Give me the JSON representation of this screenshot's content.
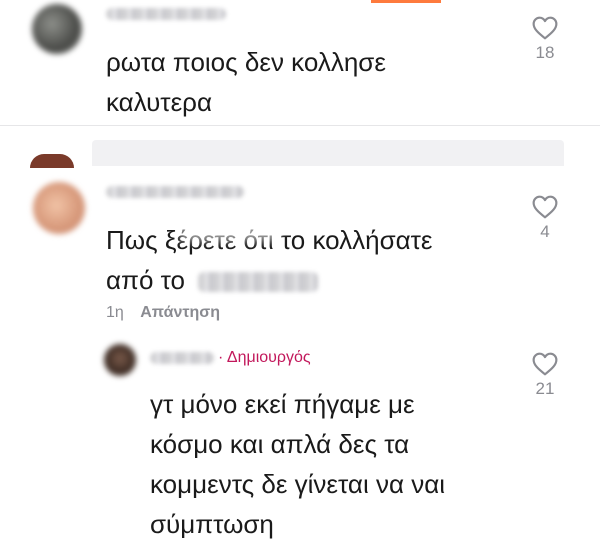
{
  "comments": [
    {
      "text_lines": [
        "ρωτα ποιος δεν κολλησε",
        "καλυτερα"
      ],
      "likes": "18",
      "heart_icon": "heart-outline-icon"
    },
    {
      "text_lines": [
        "Πως ξέρετε ότι το κολλήσατε",
        "από το"
      ],
      "likes": "4",
      "time": "1η",
      "reply_label": "Απάντηση",
      "heart_icon": "heart-outline-icon"
    }
  ],
  "reply": {
    "creator_label": "· Δημιουργός",
    "text_lines": [
      "γτ μόνο εκεί πήγαμε με",
      "κόσμο και απλά δες τα",
      "κομμεντς δε γίνεται να ναι",
      "σύμπτωση"
    ],
    "likes": "21",
    "heart_icon": "heart-outline-icon"
  },
  "colors": {
    "creator_accent": "#c2185b",
    "muted_text": "#8a8b91",
    "top_accent_bar": "#fe7a3d"
  }
}
